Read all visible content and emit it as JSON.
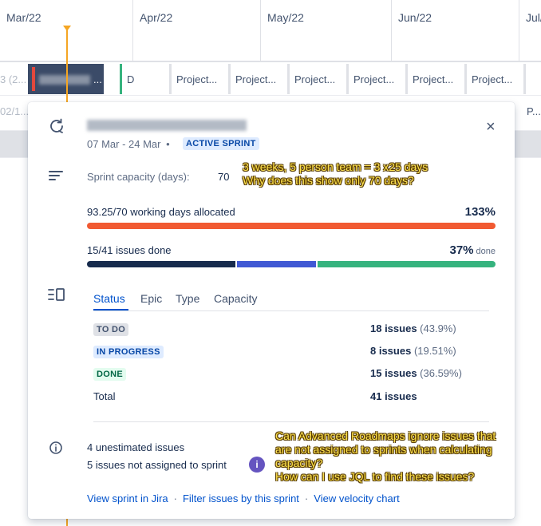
{
  "timeline": {
    "months": [
      "Mar/22",
      "Apr/22",
      "May/22",
      "Jun/22",
      "Jul/"
    ],
    "row1_ghost": "3 (2...",
    "row2_ghost": "02/1...",
    "sprint_dots": "...",
    "chip_first_partial": "D",
    "chips": [
      "Project...",
      "Project...",
      "Project...",
      "Project...",
      "Project...",
      "Project..."
    ],
    "row2_tail": "P..."
  },
  "popup": {
    "dates": "07 Mar - 24 Mar",
    "separator": "•",
    "status_badge": "ACTIVE SPRINT",
    "close_glyph": "×",
    "capacity_label": "Sprint capacity (days):",
    "capacity_value": "70",
    "allocation_text": "93.25/70 working days allocated",
    "allocation_percent": "133%",
    "allocation_fill": 100,
    "done_text": "15/41 issues done",
    "done_percent": "37%",
    "done_suffix": "done",
    "issue_segments": [
      {
        "status": "done",
        "count": 15,
        "color": "#172b4d"
      },
      {
        "status": "in_progress",
        "count": 8,
        "color": "#4059d4"
      },
      {
        "status": "todo",
        "count": 18,
        "color": "#36b37e"
      }
    ],
    "tabs": [
      "Status",
      "Epic",
      "Type",
      "Capacity"
    ],
    "status_rows": [
      {
        "label": "TO DO",
        "count": "18 issues",
        "pct": "(43.9%)"
      },
      {
        "label": "IN PROGRESS",
        "count": "8 issues",
        "pct": "(19.51%)"
      },
      {
        "label": "DONE",
        "count": "15 issues",
        "pct": "(36.59%)"
      }
    ],
    "total_label": "Total",
    "total_value": "41 issues",
    "unestimated": "4 unestimated issues",
    "not_assigned": "5 issues not assigned to sprint",
    "info_glyph": "i",
    "links": [
      "View sprint in Jira",
      "Filter issues by this sprint",
      "View velocity chart"
    ],
    "link_sep": "·"
  },
  "annotations": {
    "capacity_note": "3 weeks, 5 person team = 3 x25 days\nWhy does this show only 70 days?",
    "issues_note": "Can Advanced Roadmaps ignore issues that\nare not assigned to sprints when calculating\ncapacity?\nHow can I use JQL to find these issues?"
  },
  "colors": {
    "accent": "#0052cc",
    "over_allocated": "#f15a32",
    "today_line": "#f5a623",
    "annotation_text": "#ffe34d"
  }
}
